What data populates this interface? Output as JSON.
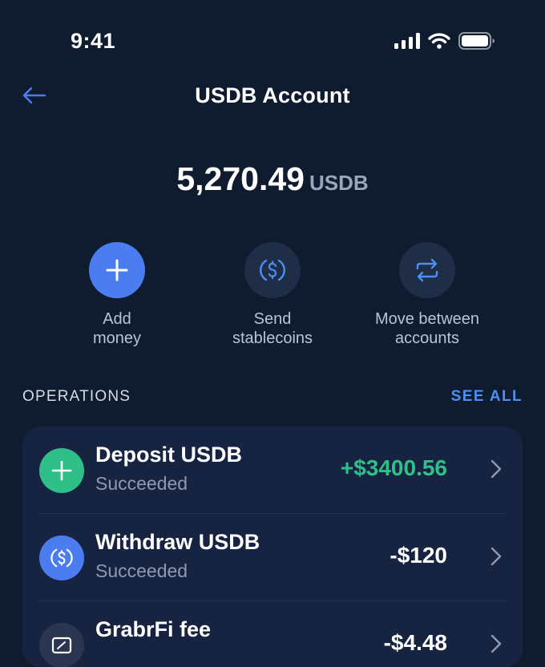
{
  "status_bar": {
    "time": "9:41"
  },
  "header": {
    "title": "USDB Account"
  },
  "balance": {
    "amount": "5,270.49",
    "currency": "USDB"
  },
  "actions": [
    {
      "line1": "Add",
      "line2": "money"
    },
    {
      "line1": "Send",
      "line2": "stablecoins"
    },
    {
      "line1": "Move between",
      "line2": "accounts"
    }
  ],
  "operations": {
    "title": "OPERATIONS",
    "see_all": "SEE ALL",
    "items": [
      {
        "name": "Deposit USDB",
        "status": "Succeeded",
        "amount": "+$3400.56",
        "icon": "plus-icon",
        "color": "#2fbf89"
      },
      {
        "name": "Withdraw USDB",
        "status": "Succeeded",
        "amount": "-$120",
        "icon": "dollar-coin-icon",
        "color": "#4b7df0"
      },
      {
        "name": "GrabrFi fee",
        "status": "",
        "amount": "-$4.48",
        "icon": "receipt-icon",
        "color": "#2a3650"
      }
    ]
  },
  "colors": {
    "background": "#0f1b2f",
    "card": "#172441",
    "accent": "#4b7df0",
    "positive": "#2fbf89",
    "link": "#4c8ff5"
  }
}
